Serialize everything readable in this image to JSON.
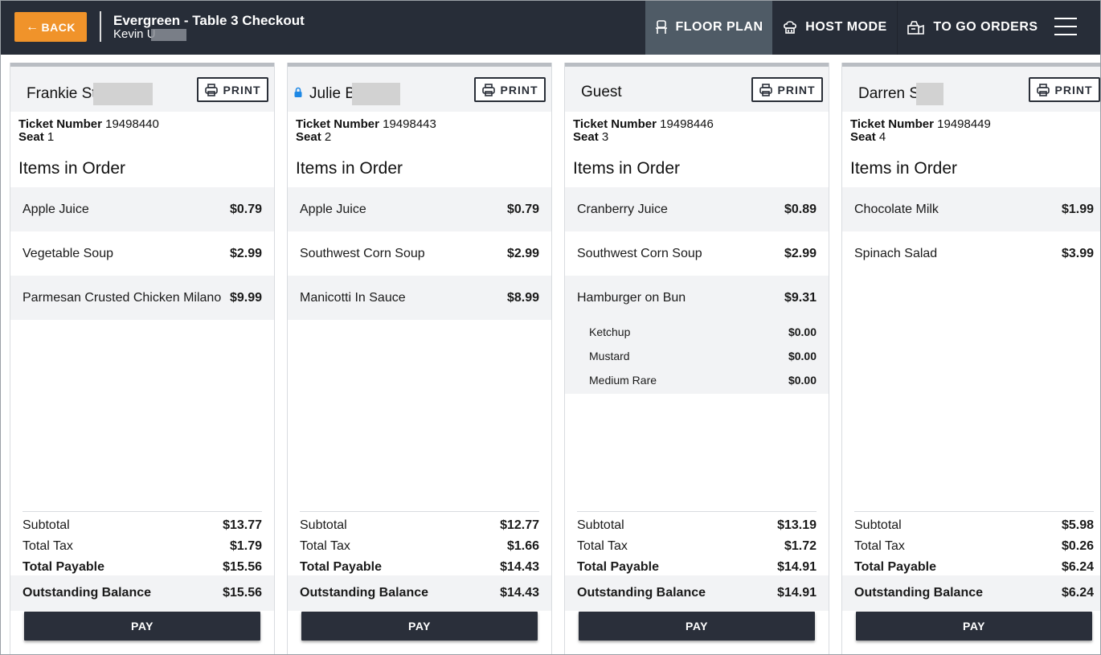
{
  "header": {
    "back_label": "BACK",
    "title": "Evergreen - Table 3 Checkout",
    "subtitle": "Kevin U",
    "nav": {
      "floor_plan": "FLOOR PLAN",
      "host_mode": "HOST MODE",
      "to_go_orders": "TO GO ORDERS"
    }
  },
  "colors": {
    "header_bg": "#272d38",
    "back_button": "#f0932a",
    "nav_active": "#4f5b66",
    "pay_button": "#2a2f3a",
    "lock_icon": "#1e88e5"
  },
  "labels": {
    "print": "PRINT",
    "ticket_number": "Ticket Number",
    "seat": "Seat",
    "items_in_order": "Items in Order",
    "subtotal": "Subtotal",
    "total_tax": "Total Tax",
    "total_payable": "Total Payable",
    "outstanding_balance": "Outstanding Balance",
    "pay": "PAY"
  },
  "checks": [
    {
      "guest": "Frankie St",
      "locked": false,
      "ticket_number": "19498440",
      "seat": "1",
      "items": [
        {
          "name": "Apple Juice",
          "price": "$0.79"
        },
        {
          "name": "Vegetable Soup",
          "price": "$2.99"
        },
        {
          "name": "Parmesan Crusted Chicken Milano",
          "price": "$9.99"
        }
      ],
      "subtotal": "$13.77",
      "total_tax": "$1.79",
      "total_payable": "$15.56",
      "outstanding_balance": "$15.56"
    },
    {
      "guest": "Julie B",
      "locked": true,
      "ticket_number": "19498443",
      "seat": "2",
      "items": [
        {
          "name": "Apple Juice",
          "price": "$0.79"
        },
        {
          "name": "Southwest Corn Soup",
          "price": "$2.99"
        },
        {
          "name": "Manicotti In Sauce",
          "price": "$8.99"
        }
      ],
      "subtotal": "$12.77",
      "total_tax": "$1.66",
      "total_payable": "$14.43",
      "outstanding_balance": "$14.43"
    },
    {
      "guest": "Guest",
      "locked": false,
      "ticket_number": "19498446",
      "seat": "3",
      "items": [
        {
          "name": "Cranberry Juice",
          "price": "$0.89"
        },
        {
          "name": "Southwest Corn Soup",
          "price": "$2.99"
        },
        {
          "name": "Hamburger on Bun",
          "price": "$9.31",
          "modifiers": [
            {
              "name": "Ketchup",
              "price": "$0.00"
            },
            {
              "name": "Mustard",
              "price": "$0.00"
            },
            {
              "name": "Medium Rare",
              "price": "$0.00"
            }
          ]
        }
      ],
      "subtotal": "$13.19",
      "total_tax": "$1.72",
      "total_payable": "$14.91",
      "outstanding_balance": "$14.91"
    },
    {
      "guest": "Darren S",
      "locked": false,
      "ticket_number": "19498449",
      "seat": "4",
      "items": [
        {
          "name": "Chocolate Milk",
          "price": "$1.99"
        },
        {
          "name": "Spinach Salad",
          "price": "$3.99"
        }
      ],
      "subtotal": "$5.98",
      "total_tax": "$0.26",
      "total_payable": "$6.24",
      "outstanding_balance": "$6.24"
    }
  ]
}
